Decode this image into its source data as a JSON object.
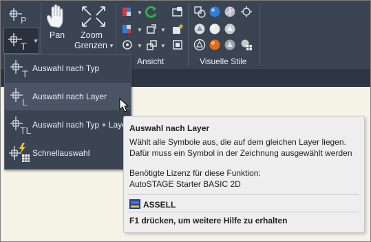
{
  "ribbon": {
    "pan_label": "Pan",
    "zoom_label_line1": "Zoom",
    "zoom_label_line2": "Grenzen",
    "group_ansicht": "Ansicht",
    "group_visuelle_stile": "Visuelle Stile"
  },
  "menu": {
    "items": [
      {
        "label": "Auswahl nach Typ",
        "icon": "select-by-type-icon",
        "icon_letter": "T"
      },
      {
        "label": "Auswahl nach Layer",
        "icon": "select-by-layer-icon",
        "icon_letter": "L"
      },
      {
        "label": "Auswahl nach Typ + Layer",
        "icon": "select-by-type-layer-icon",
        "icon_letter": "TL"
      },
      {
        "label": "Schnellauswahl",
        "icon": "quick-select-icon"
      }
    ],
    "hovered_index": 1
  },
  "toolbar_icons": {
    "select_p_letter": "P",
    "select_t_letter": "T"
  },
  "tooltip": {
    "title": "Auswahl nach Layer",
    "desc_line1": "Wählt alle Symbole aus, die auf dem gleichen Layer liegen.",
    "desc_line2": "Dafür muss ein Symbol in der Zeichnung ausgewählt werden",
    "license_label": "Benötigte Lizenz für diese Funktion:",
    "license_value": "AutoSTAGE Starter BASIC 2D",
    "brand": "ASSELL",
    "help": "F1 drücken, um weitere Hilfe zu erhalten"
  },
  "colors": {
    "ribbon_bg": "#3b4453",
    "menu_hover": "#4a5465",
    "tooltip_bg": "#eeeeee",
    "accent_blue": "#2f7fd9",
    "accent_orange": "#e06a1c",
    "accent_green": "#2bb24a"
  }
}
